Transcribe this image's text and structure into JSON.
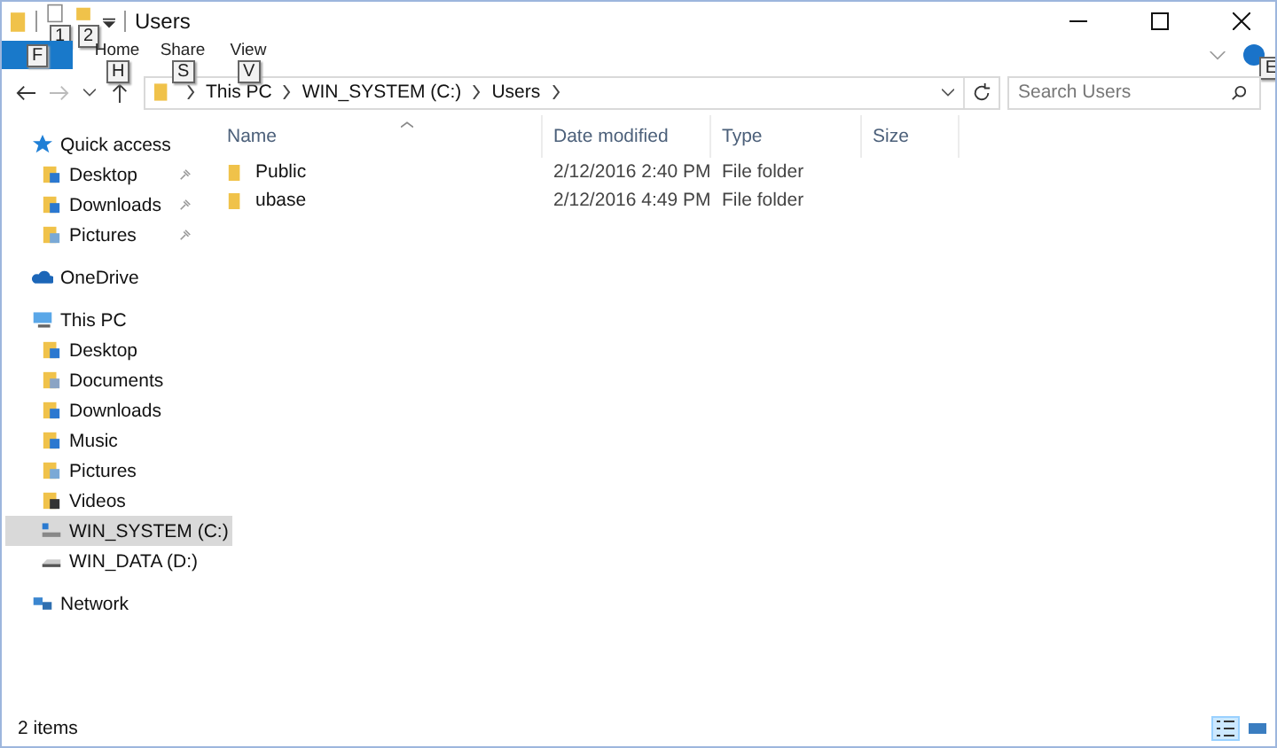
{
  "title_bar": {
    "title": "Users",
    "keytips": [
      "1",
      "2"
    ]
  },
  "ribbon": {
    "file_keytip": "F",
    "tabs": [
      {
        "label": "Home",
        "keytip": "H"
      },
      {
        "label": "Share",
        "keytip": "S"
      },
      {
        "label": "View",
        "keytip": "V"
      }
    ],
    "help_keytip": "E"
  },
  "address_bar": {
    "crumbs": [
      "This PC",
      "WIN_SYSTEM (C:)",
      "Users"
    ],
    "search": {
      "placeholder": "Search Users"
    }
  },
  "sidebar": {
    "groups": [
      {
        "label": "Quick access",
        "kind": "star",
        "selected": false,
        "children": [
          {
            "label": "Desktop",
            "kind": "desktop",
            "pinned": true,
            "selected": false
          },
          {
            "label": "Downloads",
            "kind": "downloads",
            "pinned": true,
            "selected": false
          },
          {
            "label": "Pictures",
            "kind": "pictures",
            "pinned": true,
            "selected": false
          }
        ]
      },
      {
        "label": "OneDrive",
        "kind": "cloud",
        "selected": false
      },
      {
        "label": "This PC",
        "kind": "pc",
        "selected": false,
        "children": [
          {
            "label": "Desktop",
            "kind": "desktop",
            "pinned": false,
            "selected": false
          },
          {
            "label": "Documents",
            "kind": "documents",
            "pinned": false,
            "selected": false
          },
          {
            "label": "Downloads",
            "kind": "downloads",
            "pinned": false,
            "selected": false
          },
          {
            "label": "Music",
            "kind": "music",
            "pinned": false,
            "selected": false
          },
          {
            "label": "Pictures",
            "kind": "pictures",
            "pinned": false,
            "selected": false
          },
          {
            "label": "Videos",
            "kind": "videos",
            "pinned": false,
            "selected": false
          },
          {
            "label": "WIN_SYSTEM (C:)",
            "kind": "system-drive",
            "pinned": false,
            "selected": true
          },
          {
            "label": "WIN_DATA (D:)",
            "kind": "drive",
            "pinned": false,
            "selected": false
          }
        ]
      },
      {
        "label": "Network",
        "kind": "network",
        "selected": false
      }
    ]
  },
  "table": {
    "columns": [
      "Name",
      "Date modified",
      "Type",
      "Size"
    ],
    "rows": [
      {
        "name": "Public",
        "date": "2/12/2016 2:40 PM",
        "type": "File folder"
      },
      {
        "name": "ubase",
        "date": "2/12/2016 4:49 PM",
        "type": "File folder"
      }
    ]
  },
  "status_bar": {
    "text": "2 items",
    "views": [
      {
        "kind": "details",
        "selected": true
      },
      {
        "kind": "large-icons",
        "selected": false
      }
    ]
  }
}
